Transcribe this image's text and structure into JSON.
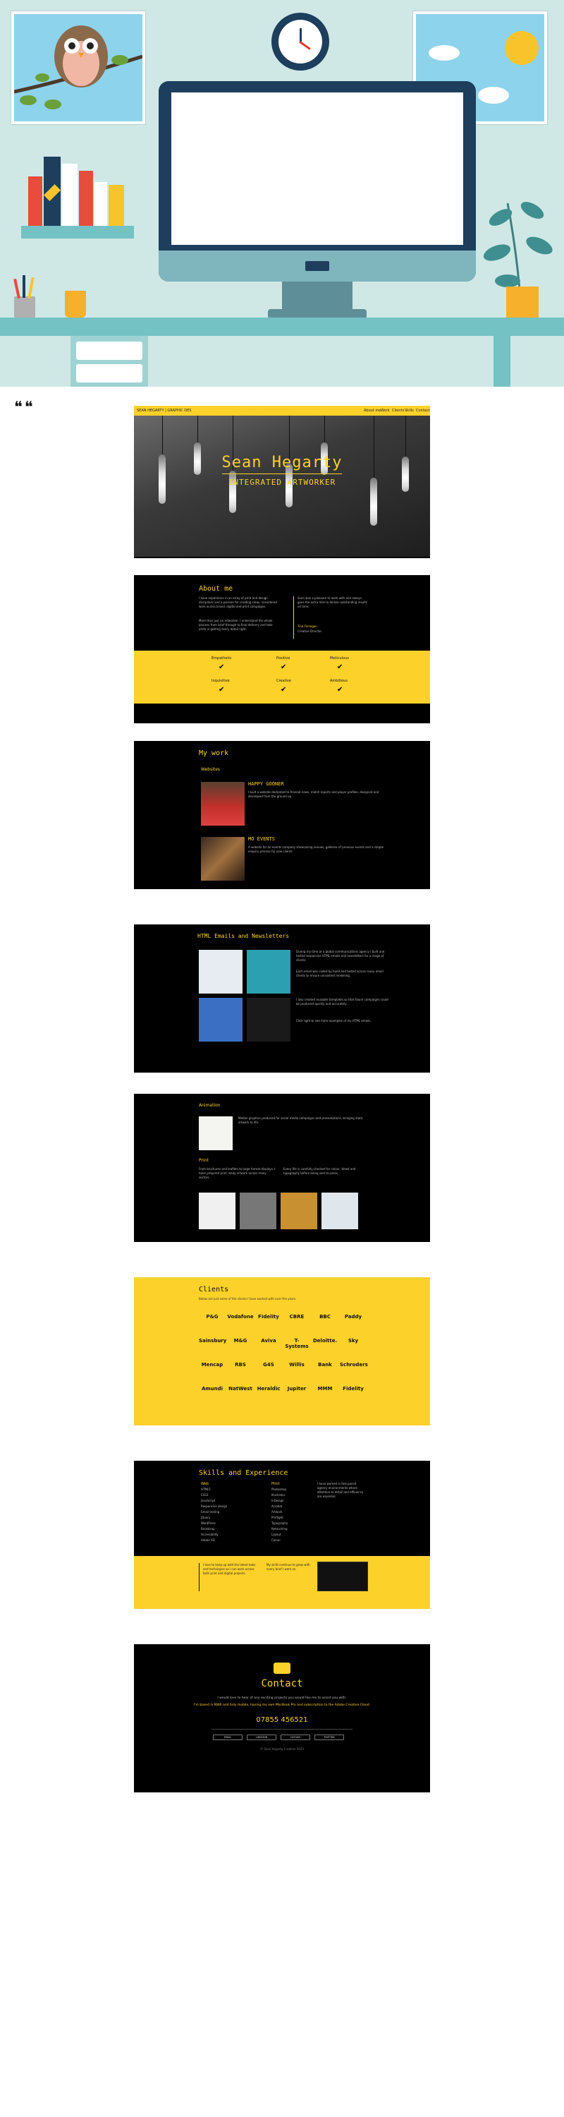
{
  "nav": {
    "brand": "SEAN HEGARTY | GRAPHIC DES",
    "links": [
      "About me",
      "Work",
      "Clients",
      "Skills",
      "Contact"
    ]
  },
  "hero": {
    "name": "Sean Hegarty",
    "tagline": "INTEGRATED ARTWORKER"
  },
  "about": {
    "heading": "About me",
    "body1": "I have experience in an array of print and design disciplines and a passion for creating clean, considered work across brand, digital and print campaigns.",
    "body2": "More than just an artworker, I understand the whole process from brief through to final delivery and take pride in getting every detail right.",
    "quote": "Sean was a pleasure to work with and always goes the extra mile to deliver outstanding results on time.",
    "quote_author": "Tina Finnegan",
    "quote_role": "Creative Director",
    "qualities": [
      "Empathetic",
      "Positive",
      "Meticulous",
      "Inquisitive",
      "Creative",
      "Ambitious"
    ]
  },
  "work": {
    "heading": "My work",
    "sub": "Websites",
    "items": [
      {
        "title": "HAPPY GOONER",
        "body": "I built a website dedicated to Arsenal news, match reports and player profiles, designed and developed from the ground up."
      },
      {
        "title": "MO EVENTS",
        "body": "A website for an events company showcasing venues, galleries of previous events and a simple enquiry process for new clients."
      }
    ]
  },
  "html_emails": {
    "heading": "HTML Emails and Newsletters",
    "body1": "During my time at a global communications agency I built and tested responsive HTML emails and newsletters for a range of clients.",
    "body2": "Each email was coded by hand and tested across many email clients to ensure consistent rendering.",
    "body3": "I also created reusable templates so that future campaigns could be produced quickly and accurately.",
    "body4": "Click right to see more examples of my HTML emails."
  },
  "animation": {
    "heading": "Animation",
    "body": "Motion graphics produced for social media campaigns and presentations, bringing static artwork to life.",
    "print_heading": "Print",
    "print_body1": "From brochures and leaflets to large format displays, I have prepared print ready artwork across many sectors.",
    "print_body2": "Every file is carefully checked for colour, bleed and typography before being sent to press."
  },
  "clients": {
    "heading": "Clients",
    "intro": "Below are just some of the clients I have worked with over the years.",
    "logos": [
      "P&G",
      "Vodafone",
      "Fidelity",
      "CBRE",
      "BBC",
      "Paddy",
      "Sainsbury",
      "M&G",
      "Aviva",
      "T-Systems",
      "Deloitte.",
      "Sky",
      "Mencap",
      "RBS",
      "G4S",
      "Willis",
      "Bank",
      "Schroders",
      "Amundi",
      "NatWest",
      "Heraldic",
      "Jupiter",
      "MMM",
      "Fidelity"
    ]
  },
  "skills": {
    "heading": "Skills and Experience",
    "col1_title": "Web",
    "col1": [
      "HTML5",
      "CSS3",
      "JavaScript",
      "Responsive design",
      "Email testing",
      "jQuery",
      "WordPress",
      "Bootstrap",
      "Accessibility",
      "Adobe XD"
    ],
    "col2_title": "Print",
    "col2": [
      "Photoshop",
      "Illustrator",
      "InDesign",
      "Acrobat",
      "Artwork",
      "Preflight",
      "Typography",
      "Retouching",
      "Layout",
      "Colour"
    ],
    "side": "I have worked in fast paced agency environments where attention to detail and efficiency are essential.",
    "quote1": "I love to keep up with the latest tools and techniques so I can work across both print and digital projects.",
    "quote2": "My skills continue to grow with every brief I work on."
  },
  "contact": {
    "heading": "Contact",
    "line1": "I would love to hear of any exciting projects you would like me to assist you with.",
    "line2": "I'm based in NW6 and fully mobile, having my own MacBook Pro and subscription to the Adobe Creative Cloud.",
    "phone": "07855 456521",
    "buttons": [
      "EMAIL",
      "LINKEDIN",
      "GITHUB",
      "TWITTER"
    ],
    "copyright": "© Sean Hegarty Creative 2023"
  },
  "colors": {
    "accent": "#fcd12a",
    "dark": "#000000",
    "hero_bg": "#cfe8e6"
  }
}
